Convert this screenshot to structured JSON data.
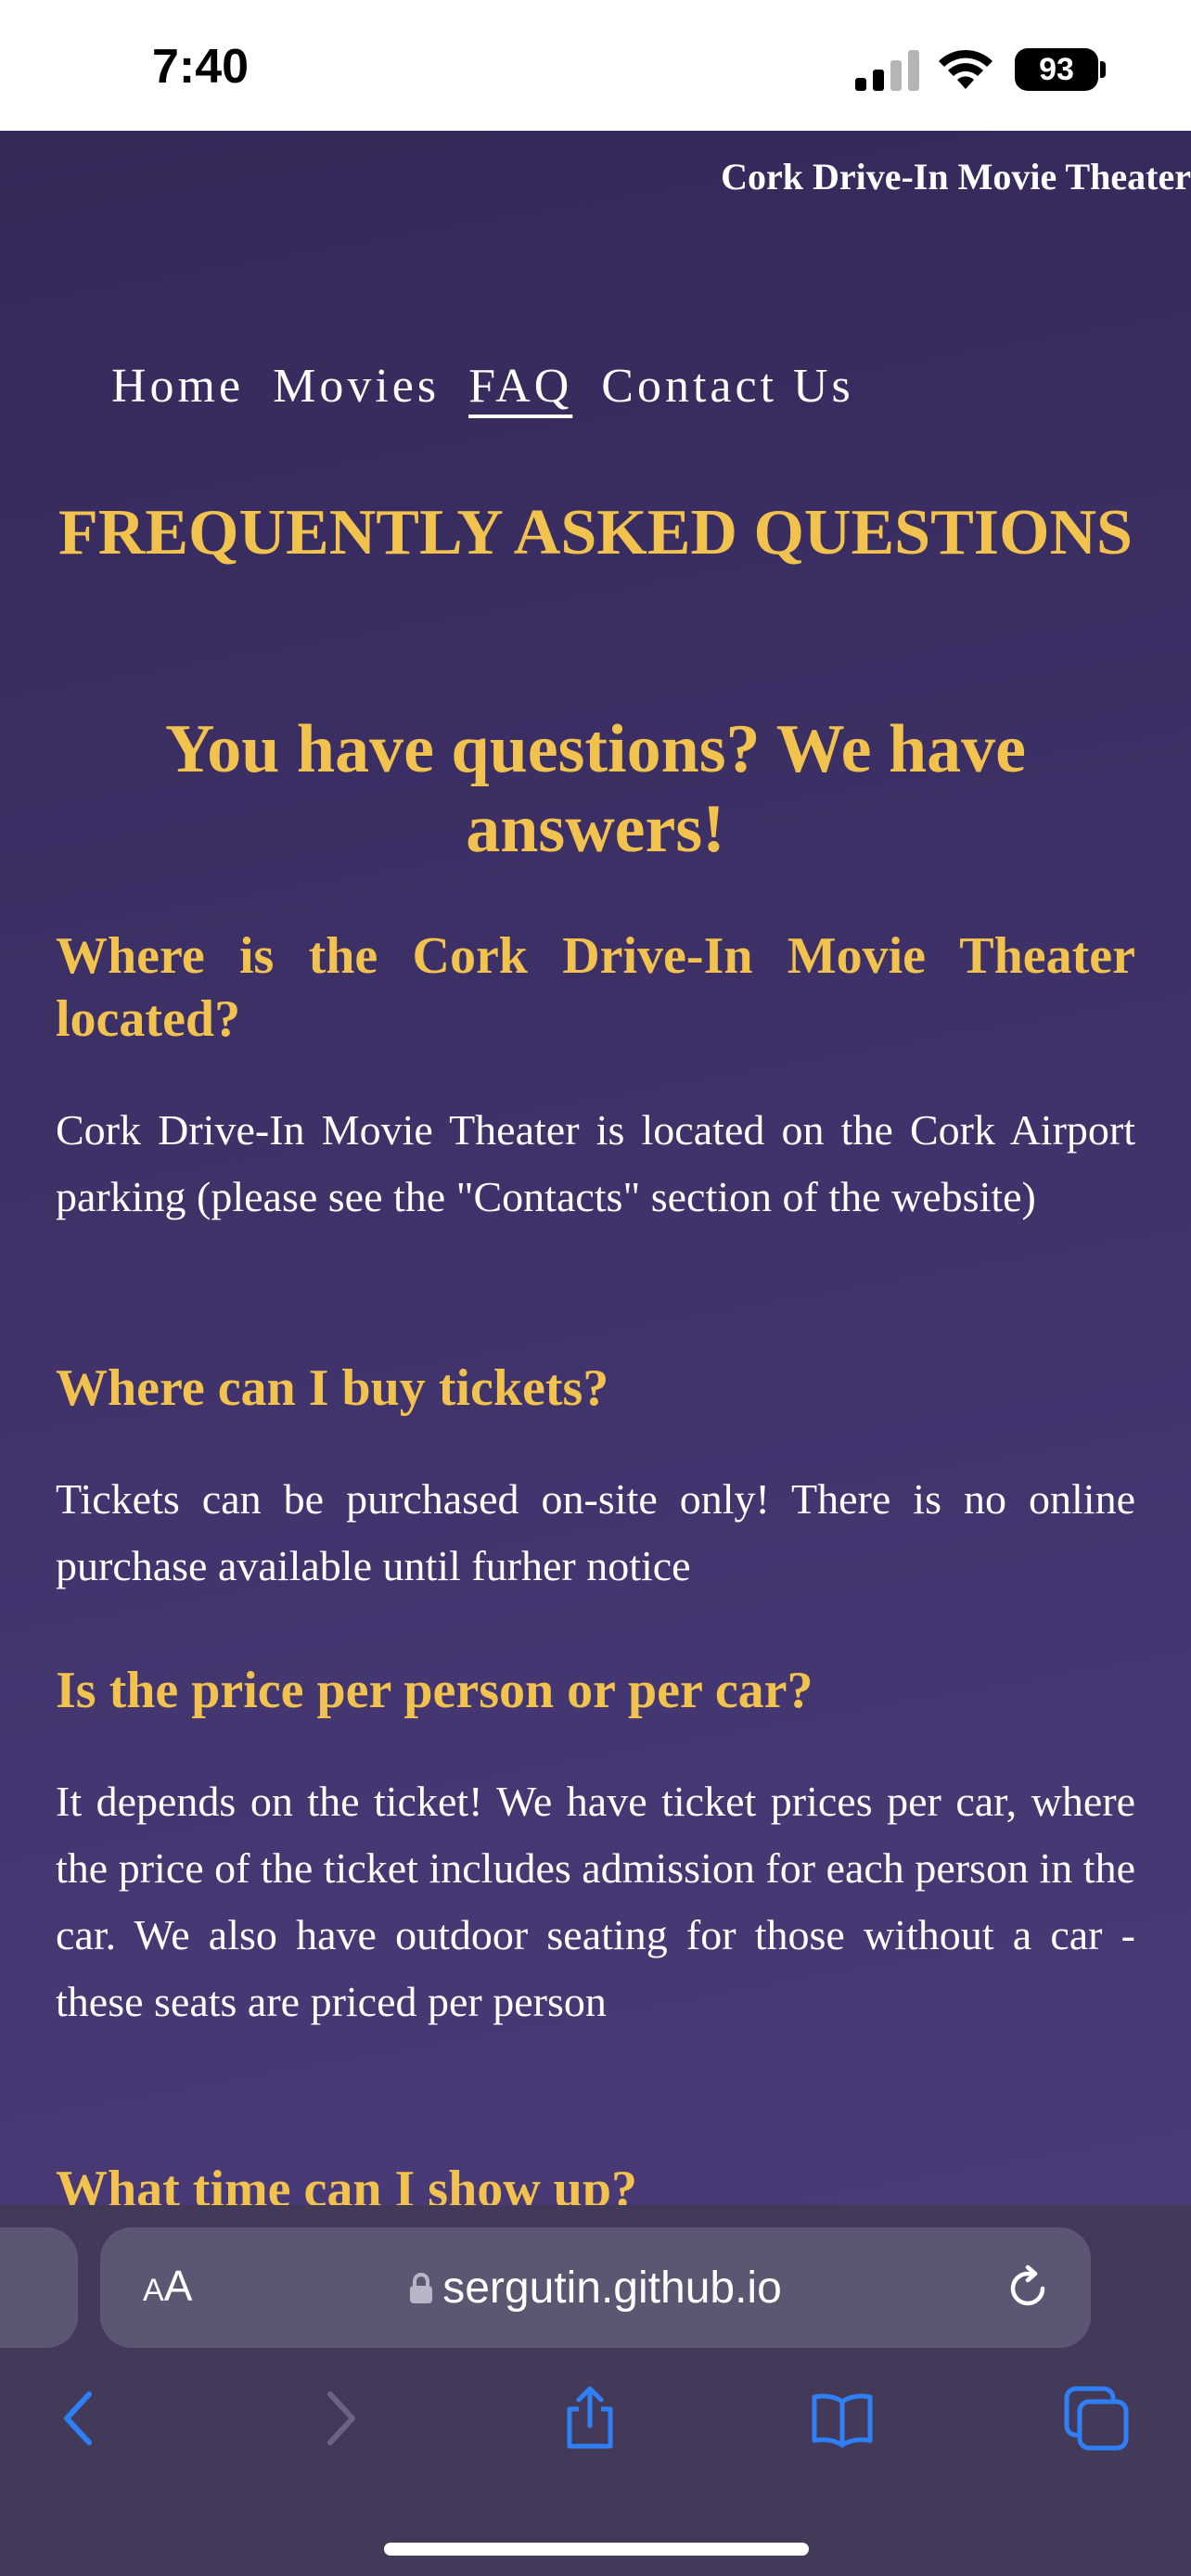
{
  "status_bar": {
    "time": "7:40",
    "battery": "93"
  },
  "header": {
    "site_title": "Cork Drive-In Movie Theater"
  },
  "nav": {
    "items": [
      "Home",
      "Movies",
      "FAQ",
      "Contact Us"
    ],
    "active": "FAQ"
  },
  "main": {
    "title": "FREQUENTLY ASKED QUESTIONS",
    "subtitle": "You have questions? We have answers!",
    "faqs": [
      {
        "q": "Where is the Cork Drive-In Movie Theater located?",
        "a": "Cork Drive-In Movie Theater is located on the Cork Airport parking (please see the \"Contacts\" section of the website)"
      },
      {
        "q": "Where can I buy tickets?",
        "a": "Tickets can be purchased on-site only! There is no online purchase available until furher notice"
      },
      {
        "q": "Is the price per person or per car?",
        "a": "It depends on the ticket! We have ticket prices per car, where the price of the ticket includes admission for each person in the car. We also have outdoor seating for those without a car - these seats are priced per person"
      },
      {
        "q": "What time can I show up?"
      }
    ]
  },
  "browser": {
    "aa_label": "AA",
    "url": "sergutin.github.io",
    "toolbar": [
      "back-icon",
      "forward-icon",
      "share-icon",
      "bookmarks-icon",
      "tabs-icon"
    ]
  },
  "colors": {
    "accent": "#f2c24e",
    "page_bg": "#3a2f60",
    "chrome_bg": "#423a58",
    "ios_blue": "#2f7ff7"
  }
}
